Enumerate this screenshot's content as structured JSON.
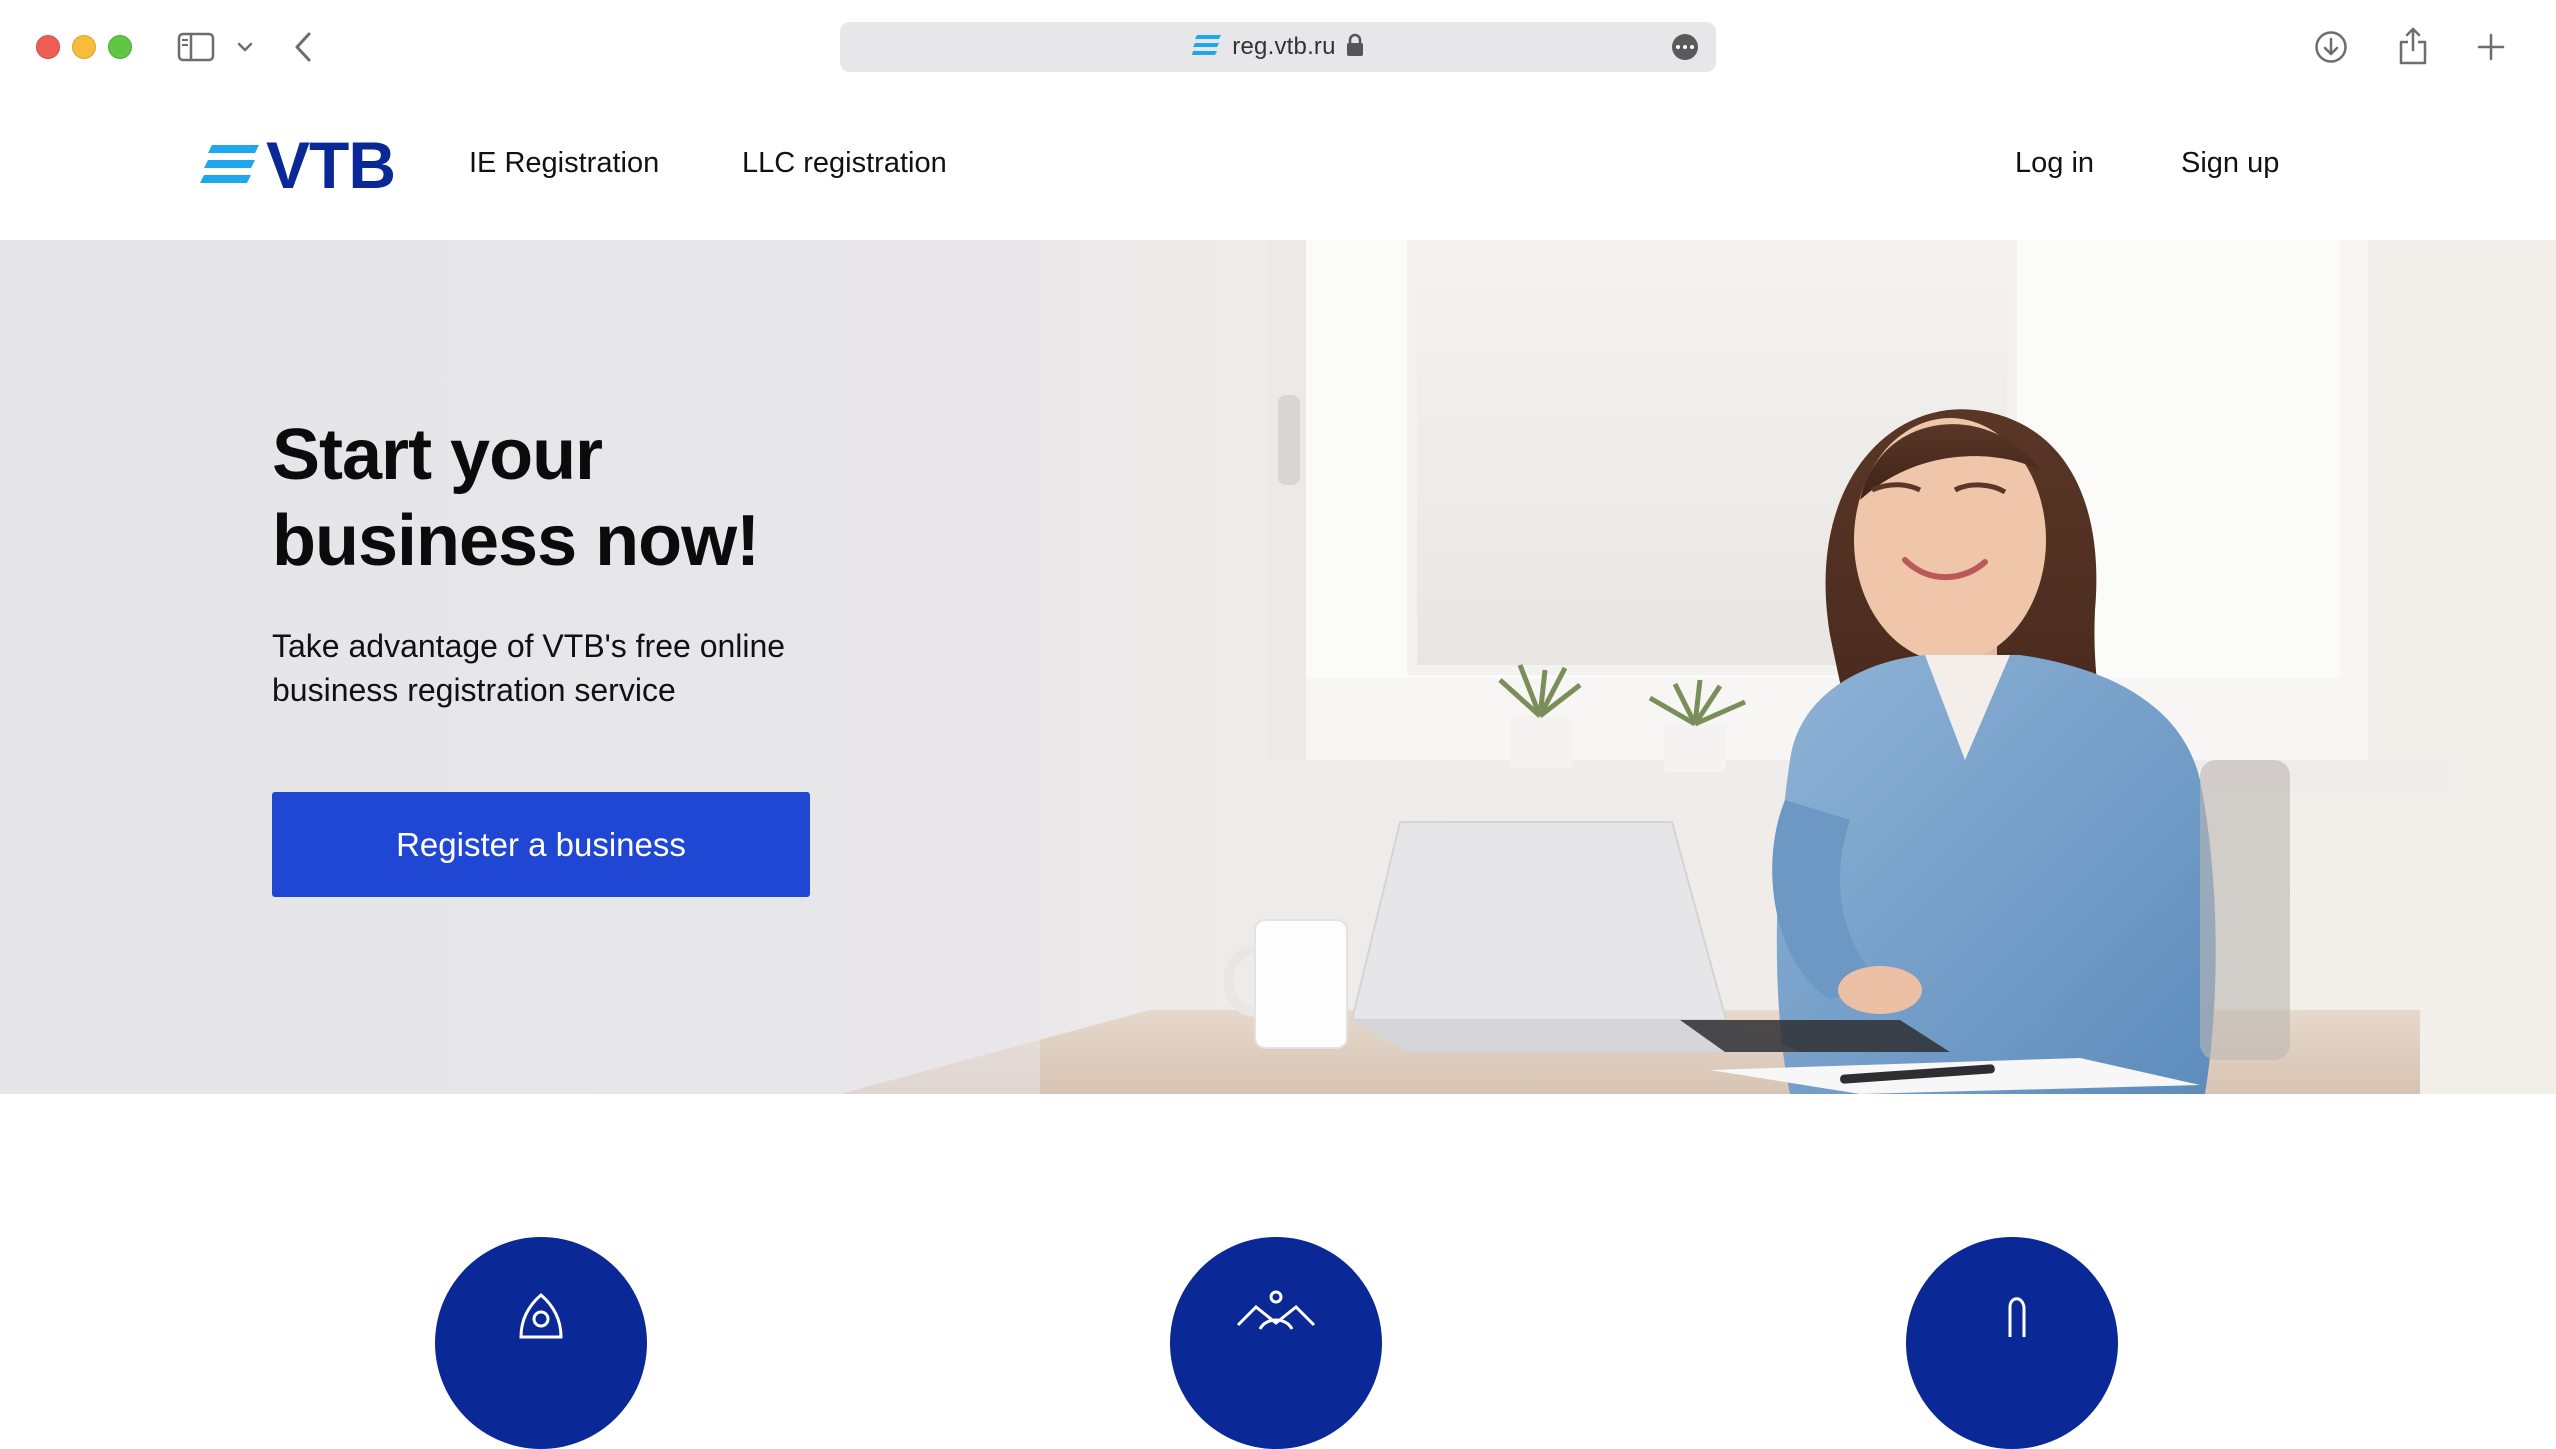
{
  "browser": {
    "url": "reg.vtb.ru",
    "icons": [
      "close-window",
      "minimize-window",
      "zoom-window",
      "sidebar-icon",
      "chevron-down-icon",
      "back-arrow-icon",
      "vtb-favicon",
      "lock-icon",
      "more-icon",
      "download-icon",
      "share-icon",
      "plus-icon"
    ]
  },
  "header": {
    "logo_text": "VTB",
    "nav": {
      "ie_registration": "IE Registration",
      "llc_registration": "LLC registration",
      "log_in": "Log in",
      "sign_up": "Sign up"
    }
  },
  "hero": {
    "title_line1": "Start your",
    "title_line2": "business now!",
    "subtitle_line1": "Take advantage of VTB's free online",
    "subtitle_line2": "business registration service",
    "cta_label": "Register a business"
  },
  "features": {
    "icons": [
      "rocket-icon",
      "crown-icon",
      "thumbs-up-icon"
    ]
  },
  "colors": {
    "brand_blue": "#0a2896",
    "logo_cyan": "#20a6ee",
    "cta_blue": "#1f47d4"
  }
}
